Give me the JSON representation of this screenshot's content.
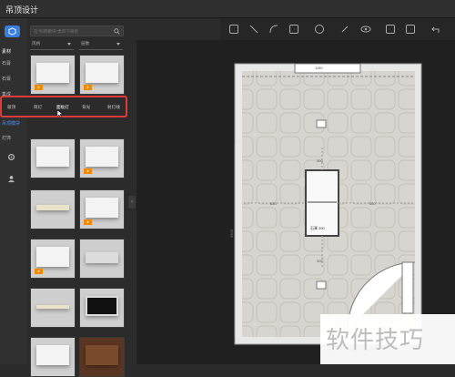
{
  "app": {
    "title": "吊顶设计"
  },
  "rail": {
    "items": [
      {
        "label": "素材"
      },
      {
        "label": "石膏"
      },
      {
        "label": "石膏"
      },
      {
        "label": "集成"
      },
      {
        "label": "吊顶模块"
      },
      {
        "label": "灯饰"
      }
    ]
  },
  "search": {
    "placeholder": "在\"照明模块\"类目下搜索"
  },
  "filters": {
    "left": "风格",
    "right": "层数"
  },
  "subtabs": [
    "吸顶",
    "筒灯",
    "面板灯",
    "射灯",
    "背光",
    "射灯线"
  ],
  "canvas": {
    "dims": {
      "top": "1180",
      "top_inner": "300",
      "left_gap": "653",
      "right_gap": "660",
      "left_height": "3500",
      "pieces_top": "300",
      "pieces_bottom": "300",
      "center_len": "1200",
      "fixture_label": "石膏 390"
    }
  },
  "watermark": {
    "text": "软件技巧"
  },
  "colors": {
    "accent": "#3a7ee0",
    "highlight": "#e03a3a",
    "badge": "#f08a00"
  }
}
